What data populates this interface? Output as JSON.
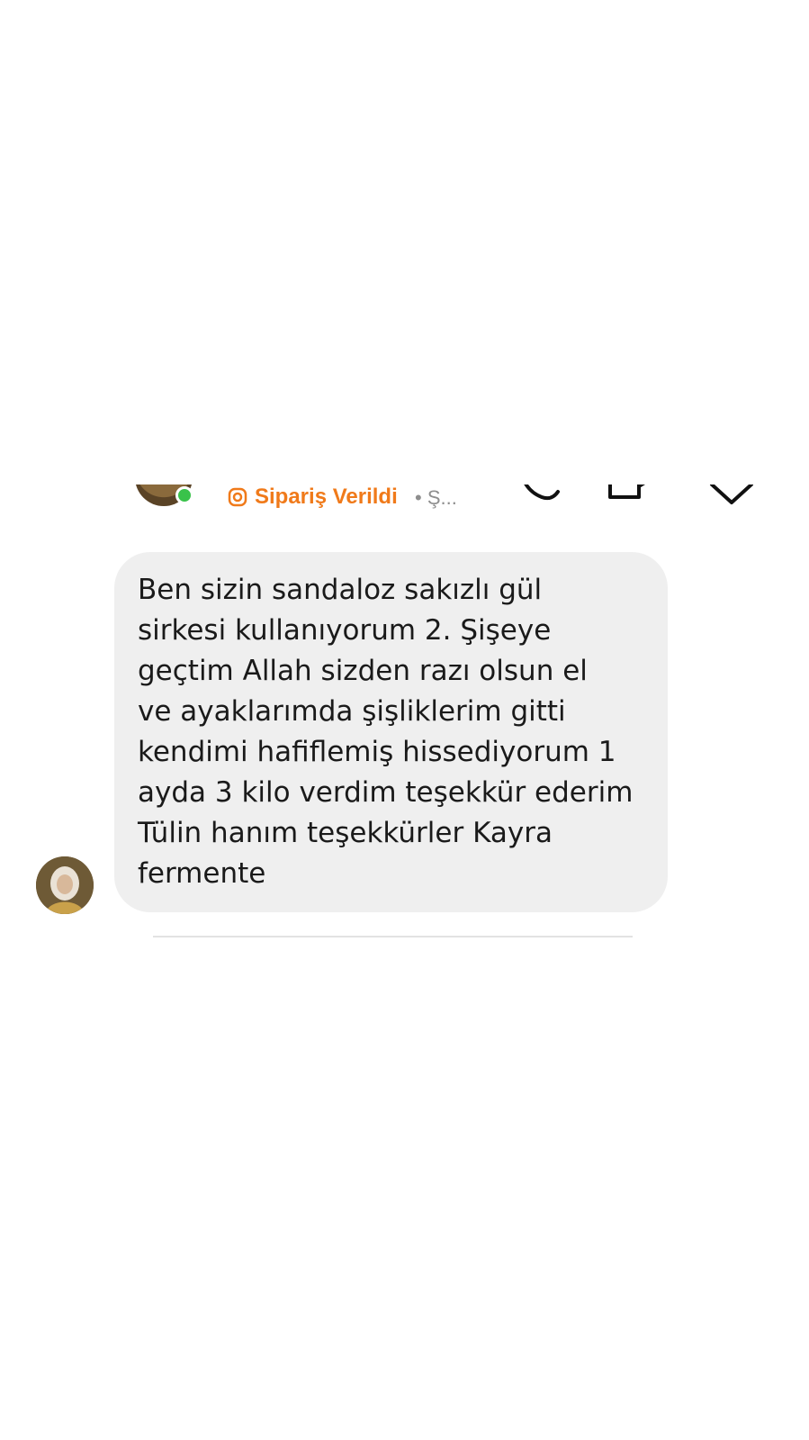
{
  "header": {
    "back_icon": "back-arrow-icon",
    "order_status": {
      "icon": "order-badge-icon",
      "label": "Sipariş Verildi",
      "extra": "• Ş...",
      "color": "#f07a1a"
    },
    "online_indicator_color": "#39c24a",
    "actions": [
      {
        "icon": "phone-icon"
      },
      {
        "icon": "video-icon"
      },
      {
        "icon": "chevron-down-icon"
      }
    ]
  },
  "message": {
    "text": "Ben sizin sandaloz sakızlı gül\nsirkesi kullanıyorum 2. Şişeye\ngeçtim Allah sizden razı olsun el\nve ayaklarımda şişliklerim gitti\nkendimi hafiflemiş hissediyorum 1\nayda 3 kilo verdim teşekkür ederim\nTülin hanım teşekkürler Kayra\nfermente",
    "bubble_color": "#efefef"
  }
}
